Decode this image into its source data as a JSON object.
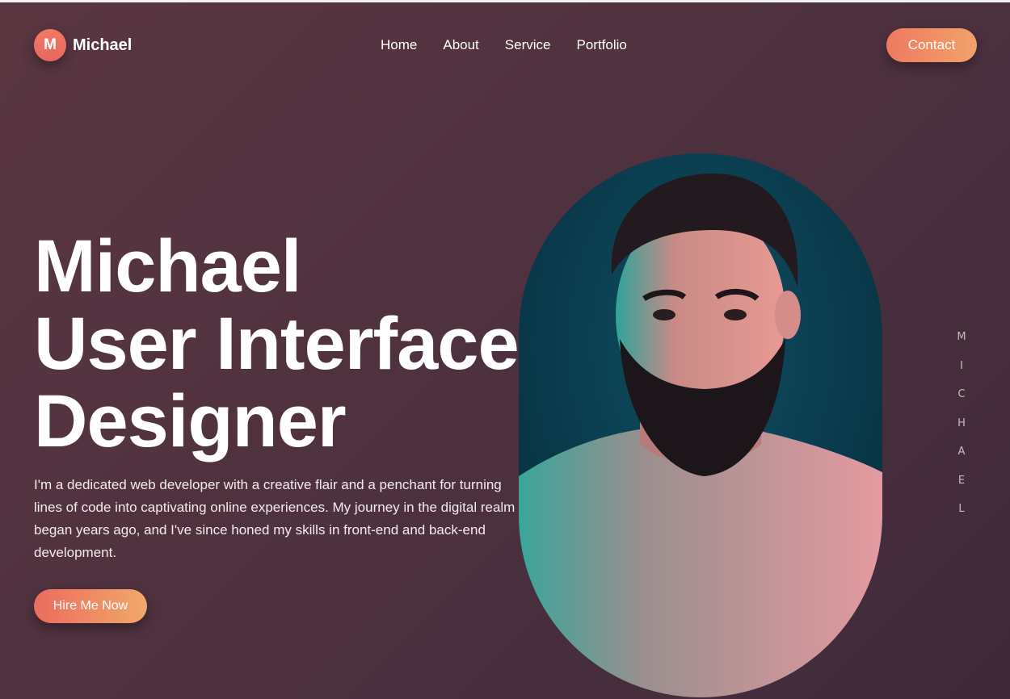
{
  "logo": {
    "initial": "M",
    "name": "Michael"
  },
  "nav": {
    "items": [
      "Home",
      "About",
      "Service",
      "Portfolio"
    ]
  },
  "contact_label": "Contact",
  "hero": {
    "lines": [
      "Michael",
      "User Interface",
      "Designer"
    ],
    "description": "I'm a dedicated web developer with a creative flair and a penchant for turning lines of code into captivating online experiences. My journey in the digital realm began years ago, and I've since honed my skills in front-end and back-end development.",
    "cta_label": "Hire Me Now"
  },
  "side_text": [
    "M",
    "I",
    "C",
    "H",
    "A",
    "E",
    "L"
  ],
  "colors": {
    "accent_start": "#ef7a62",
    "accent_end": "#f1a268",
    "background": "#4e313f"
  }
}
